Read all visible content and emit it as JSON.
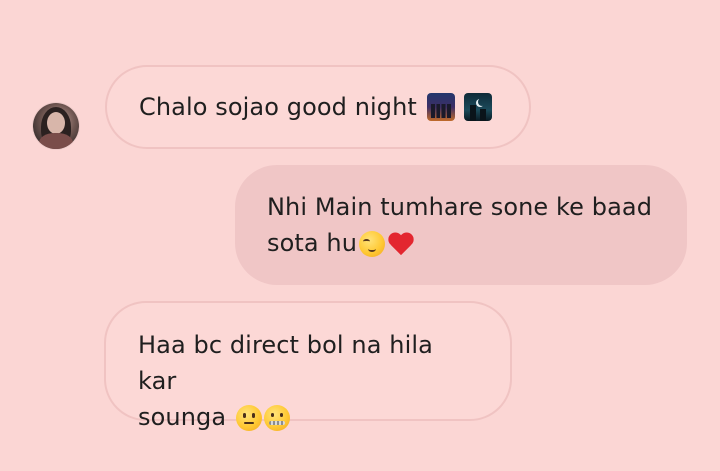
{
  "chat": {
    "contact": {
      "avatar": "avatar-photo"
    },
    "messages": [
      {
        "direction": "incoming",
        "text": "Chalo sojao good night",
        "emojis": [
          "night-city-icon",
          "night-moon-icon"
        ]
      },
      {
        "direction": "outgoing",
        "text": "Nhi Main tumhare sone ke baad\nsota hu",
        "emojis": [
          "blushing-face-icon",
          "red-heart-icon"
        ]
      },
      {
        "direction": "incoming",
        "text": "Haa bc direct bol na hila kar\nsounga ",
        "emojis": [
          "neutral-face-icon",
          "zipper-mouth-face-icon"
        ]
      }
    ]
  },
  "colors": {
    "background": "#fbd6d4",
    "incoming_bubble": "#fcd8d6",
    "incoming_border": "#f0c3c2",
    "outgoing_bubble": "#f0c6c6",
    "text": "#1f1f1f",
    "heart": "#e3262f"
  }
}
